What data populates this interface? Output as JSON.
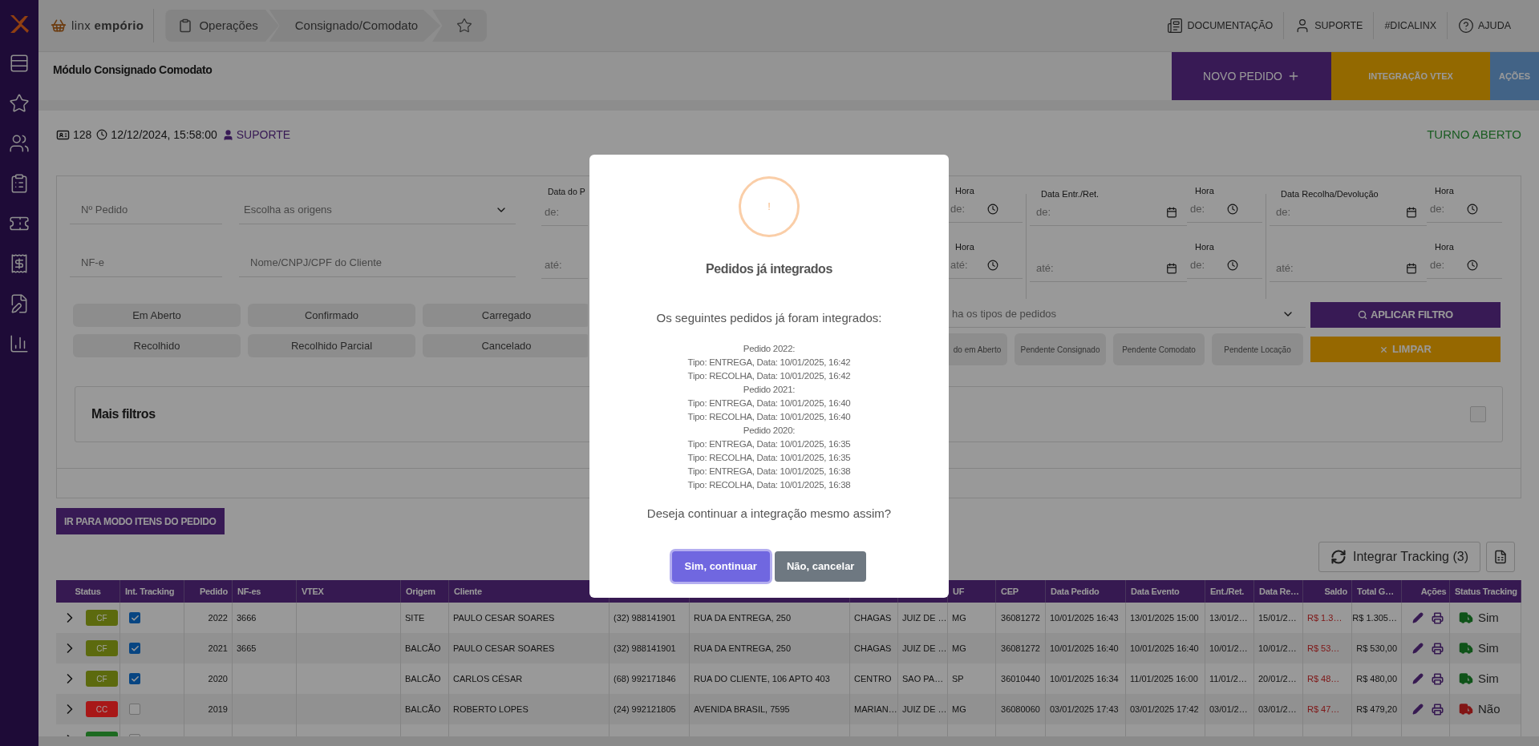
{
  "topbar": {
    "brand": "linx **empório**",
    "breadcrumb": [
      "Operações",
      "Consignado/Comodato"
    ],
    "links": [
      "DOCUMENTAÇÃO",
      "SUPORTE",
      "#DICALINX",
      "AJUDA"
    ]
  },
  "page": {
    "title": "Módulo Consignado Comodato",
    "actions": [
      "NOVO PEDIDO",
      "INTEGRAÇÃO VTEX",
      "AÇÕES"
    ]
  },
  "session": {
    "id": "128",
    "datetime": "12/12/2024, 15:58:00",
    "user": "SUPORTE",
    "shift": "TURNO ABERTO"
  },
  "filters": {
    "left_fields": [
      {
        "placeholder": "Nº Pedido",
        "kind": "text"
      },
      {
        "placeholder": "Escolha as origens",
        "kind": "select"
      },
      {
        "placeholder": "NF-e",
        "kind": "text"
      },
      {
        "placeholder": "Nome/CNPJ/CPF do Cliente",
        "kind": "text"
      }
    ],
    "order_date": {
      "label": "Data do P",
      "rows": [
        {
          "placeholder": "de:"
        },
        {
          "placeholder": "até:"
        }
      ]
    },
    "right_columns": [
      {
        "kind": "time",
        "rows": [
          {
            "label": "Hora",
            "placeholder": "de:"
          },
          {
            "label": "Hora",
            "placeholder": "até:"
          }
        ]
      },
      {
        "kind": "date",
        "label": "Data Entr./Ret.",
        "rows": [
          {
            "placeholder": "de:"
          },
          {
            "placeholder": "até:"
          }
        ]
      },
      {
        "kind": "time",
        "rows": [
          {
            "label": "Hora",
            "placeholder": "de:"
          },
          {
            "label": "Hora",
            "placeholder": "de:"
          }
        ]
      },
      {
        "kind": "date",
        "label": "Data Recolha/Devolução",
        "rows": [
          {
            "placeholder": "de:"
          },
          {
            "placeholder": "até:"
          }
        ]
      },
      {
        "kind": "time",
        "rows": [
          {
            "label": "Hora",
            "placeholder": "de:"
          },
          {
            "label": "Hora",
            "placeholder": "de:"
          }
        ]
      }
    ],
    "status_buttons": [
      "Em Aberto",
      "Confirmado",
      "Carregado",
      "Recolhido",
      "Recolhido Parcial",
      "Cancelado"
    ],
    "type_select": {
      "placeholder": "ha os tipos de pedidos"
    },
    "pending_buttons": [
      "do em Aberto",
      "Pendente Consignado",
      "Pendente Comodato",
      "Pendente Locação"
    ],
    "apply": "APLICAR FILTRO",
    "clear": "LIMPAR",
    "more_filters": {
      "label": "Mais filtros",
      "checked": false
    }
  },
  "items_mode_button": "IR PARA MODO ITENS DO PEDIDO",
  "tracking_button": "Integrar Tracking (3)",
  "table": {
    "columns": [
      {
        "label": "Status"
      },
      {
        "label": "Int. Tracking"
      },
      {
        "label": "Pedido"
      },
      {
        "label": "NF-es"
      },
      {
        "label": "VTEX"
      },
      {
        "label": "Origem"
      },
      {
        "label": "Cliente"
      },
      null,
      null,
      null,
      null,
      {
        "label": "UF"
      },
      {
        "label": "CEP"
      },
      {
        "label": "Data Pedido"
      },
      {
        "label": "Data Evento"
      },
      {
        "label": "Ent./Ret."
      },
      {
        "label": "Data Re…"
      },
      {
        "label": "Saldo"
      },
      {
        "label": "Total G…"
      },
      {
        "label": "Ações"
      },
      {
        "label": "Status Tracking"
      }
    ],
    "rows": [
      {
        "status": {
          "label": "CF",
          "color": "#5c6a0e"
        },
        "tracking": true,
        "pedido": "2022",
        "nfe": "3666",
        "origem": "SITE",
        "cliente": "PAULO CESAR SOARES",
        "telefone": "(32) 988141901",
        "endereco": "RUA DA ENTREGA, 250",
        "bairro": "CHAGAS",
        "cidade": "JUIZ DE …",
        "uf": "MG",
        "cep": "36081272",
        "data_pedido": "10/01/2025 16:43",
        "data_evento": "13/01/2025 15:00",
        "ent_ret": "13/01/2…",
        "data_re": "15/01/2…",
        "saldo": "R$ 1.3…",
        "total": "R$ 1.305…",
        "tracking_status": {
          "label": "Sim",
          "ok": true
        }
      },
      {
        "status": {
          "label": "CF",
          "color": "#5c6a0e"
        },
        "tracking": true,
        "pedido": "2021",
        "nfe": "3665",
        "origem": "BALCÃO",
        "cliente": "PAULO CESAR SOARES",
        "telefone": "(32) 988141901",
        "endereco": "RUA DA ENTREGA, 250",
        "bairro": "CHAGAS",
        "cidade": "JUIZ DE …",
        "uf": "MG",
        "cep": "36081272",
        "data_pedido": "10/01/2025 16:40",
        "data_evento": "10/01/2025 16:40",
        "ent_ret": "10/01/2…",
        "data_re": "10/01/2…",
        "saldo": "R$ 53…",
        "total": "R$ 530,00",
        "tracking_status": {
          "label": "Sim",
          "ok": true
        }
      },
      {
        "status": {
          "label": "CF",
          "color": "#5c6a0e"
        },
        "tracking": true,
        "pedido": "2020",
        "origem": "BALCÃO",
        "cliente": "CARLOS CÉSAR",
        "telefone": "(68) 992171846",
        "endereco": "RUA DO CLIENTE, 106 APTO 403",
        "bairro": "CENTRO",
        "cidade": "SAO PA…",
        "uf": "SP",
        "cep": "36010440",
        "data_pedido": "10/01/2025 16:34",
        "data_evento": "11/01/2025 16:00",
        "ent_ret": "11/01/2…",
        "data_re": "20/01/2…",
        "saldo": "R$ 48…",
        "total": "R$ 480,00",
        "tracking_status": {
          "label": "Sim",
          "ok": true
        }
      },
      {
        "status": {
          "label": "CC",
          "color": "#a81818"
        },
        "tracking": false,
        "pedido": "2019",
        "origem": "BALCÃO",
        "cliente": "ROBERTO LOPES",
        "telefone": "(24) 992121805",
        "endereco": "AVENIDA BRASIL, 7595",
        "bairro": "MARIAN…",
        "cidade": "JUIZ DE …",
        "uf": "MG",
        "cep": "36080060",
        "data_pedido": "03/01/2025 17:43",
        "data_evento": "03/01/2025 17:42",
        "ent_ret": "03/01/2…",
        "data_re": "03/01/2…",
        "saldo": "R$ 47…",
        "total": "R$ 479,20",
        "tracking_status": {
          "label": "Não",
          "ok": false
        }
      },
      {
        "status": {
          "color": "#1d6a21"
        },
        "tracking": false
      }
    ]
  },
  "modal": {
    "alert_mark": "!",
    "title": "Pedidos já integrados",
    "intro": "Os seguintes pedidos já foram integrados:",
    "details": [
      "Pedido 2022:",
      "Tipo: ENTREGA, Data: 10/01/2025, 16:42",
      "Tipo: RECOLHA, Data: 10/01/2025, 16:42",
      "Pedido 2021:",
      "Tipo: ENTREGA, Data: 10/01/2025, 16:40",
      "Tipo: RECOLHA, Data: 10/01/2025, 16:40",
      "Pedido 2020:",
      "Tipo: ENTREGA, Data: 10/01/2025, 16:35",
      "Tipo: RECOLHA, Data: 10/01/2025, 16:35",
      "Tipo: ENTREGA, Data: 10/01/2025, 16:38",
      "Tipo: RECOLHA, Data: 10/01/2025, 16:38"
    ],
    "question": "Deseja continuar a integração mesmo assim?",
    "confirm": "Sim, continuar",
    "cancel": "Não, cancelar"
  }
}
